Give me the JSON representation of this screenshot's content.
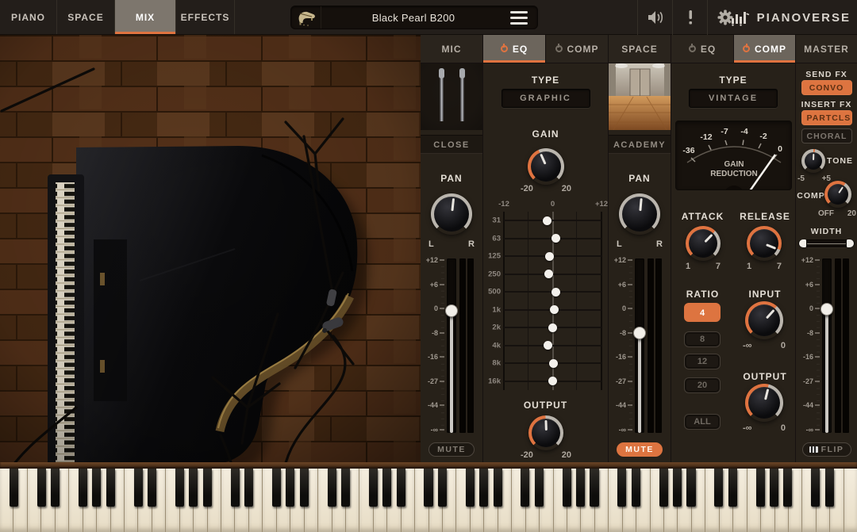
{
  "topbar": {
    "tabs": [
      {
        "label": "PIANO",
        "active": false
      },
      {
        "label": "SPACE",
        "active": false
      },
      {
        "label": "MIX",
        "active": true
      },
      {
        "label": "EFFECTS",
        "active": false
      }
    ],
    "preset": {
      "name": "Black Pearl B200"
    },
    "brand": "PIANOVERSE"
  },
  "mixer": {
    "accent": "#df7340",
    "section_tabs": [
      {
        "label": "MIC",
        "power": null,
        "active": false
      },
      {
        "label": "EQ",
        "power": "on",
        "active": true
      },
      {
        "label": "COMP",
        "power": "off",
        "active": false
      },
      {
        "label": "SPACE",
        "power": null,
        "active": false
      },
      {
        "label": "EQ",
        "power": "off",
        "active": false
      },
      {
        "label": "COMP",
        "power": "on",
        "active": true
      },
      {
        "label": "MASTER",
        "power": null,
        "active": false
      }
    ],
    "mic": {
      "name": "CLOSE",
      "pan": {
        "label": "PAN",
        "left": "L",
        "right": "R",
        "pointer_deg": 6,
        "ring": "full"
      },
      "fader": {
        "scale": [
          "+12",
          "+6",
          "0",
          "-8",
          "-16",
          "-27",
          "-44",
          "-∞"
        ],
        "handle_frac": 0.3,
        "value_db": 0
      },
      "mute": {
        "label": "MUTE",
        "active": false
      }
    },
    "eq": {
      "type_label": "TYPE",
      "type_value": "GRAPHIC",
      "gain": {
        "label": "GAIN",
        "min": "-20",
        "max": "20",
        "pointer_deg": -24,
        "ring": "value"
      },
      "bands_header": [
        "-12",
        "0",
        "+12"
      ],
      "bands": [
        {
          "freq": "31",
          "gain_db": -1.4
        },
        {
          "freq": "63",
          "gain_db": 0.7
        },
        {
          "freq": "125",
          "gain_db": -0.8
        },
        {
          "freq": "250",
          "gain_db": -0.9
        },
        {
          "freq": "500",
          "gain_db": 0.7
        },
        {
          "freq": "1k",
          "gain_db": 0.3
        },
        {
          "freq": "2k",
          "gain_db": 0
        },
        {
          "freq": "4k",
          "gain_db": -1.2
        },
        {
          "freq": "8k",
          "gain_db": 0.1
        },
        {
          "freq": "16k",
          "gain_db": 0
        }
      ],
      "output": {
        "label": "OUTPUT",
        "min": "-20",
        "max": "20",
        "pointer_deg": -2,
        "ring": "value"
      }
    },
    "space": {
      "name": "ACADEMY",
      "pan": {
        "label": "PAN",
        "left": "L",
        "right": "R",
        "pointer_deg": 5,
        "ring": "full"
      },
      "fader": {
        "scale": [
          "+12",
          "+6",
          "0",
          "-8",
          "-16",
          "-27",
          "-44",
          "-∞"
        ],
        "handle_frac": 0.43,
        "value_db": -7
      },
      "mute": {
        "label": "MUTE",
        "active": true
      }
    },
    "comp": {
      "type_label": "TYPE",
      "type_value": "VINTAGE",
      "meter": {
        "labels": [
          "-36",
          "-12",
          "-7",
          "-4",
          "-2",
          "0"
        ],
        "caption_line1": "GAIN",
        "caption_line2": "REDUCTION",
        "needle_deg": 58
      },
      "attack": {
        "label": "ATTACK",
        "min": "1",
        "max": "7",
        "pointer_deg": 44,
        "ring": "value"
      },
      "release": {
        "label": "RELEASE",
        "min": "1",
        "max": "7",
        "pointer_deg": 112,
        "ring": "value"
      },
      "ratio": {
        "label": "RATIO",
        "options": [
          "4",
          "8",
          "12",
          "20",
          "ALL"
        ],
        "selected": "4"
      },
      "input": {
        "label": "INPUT",
        "min": "-∞",
        "max": "0",
        "pointer_deg": 42,
        "ring": "value"
      },
      "output": {
        "label": "OUTPUT",
        "min": "-∞",
        "max": "0",
        "pointer_deg": 14,
        "ring": "value"
      }
    },
    "master": {
      "send_fx_label": "SEND FX",
      "send_fx_button": {
        "label": "CONVO",
        "active": true
      },
      "insert_fx_label": "INSERT FX",
      "insert_buttons": [
        {
          "label": "PARTCLS",
          "active": true
        },
        {
          "label": "CHORAL",
          "active": false
        }
      ],
      "tone": {
        "label": "TONE",
        "min": "-5",
        "max": "+5",
        "pointer_deg": 2,
        "ring": "center"
      },
      "comp": {
        "label": "COMP",
        "min": "OFF",
        "max": "20",
        "pointer_deg": 34,
        "ring": "value"
      },
      "width": {
        "label": "WIDTH"
      },
      "fader": {
        "scale": [
          "+12",
          "+6",
          "0",
          "-8",
          "-16",
          "-27",
          "-44",
          "-∞"
        ],
        "handle_frac": 0.29,
        "value_db": 0
      },
      "flip": {
        "label": "FLIP"
      }
    }
  },
  "keyboard": {
    "start_note": "A",
    "white_key_count": 62
  }
}
